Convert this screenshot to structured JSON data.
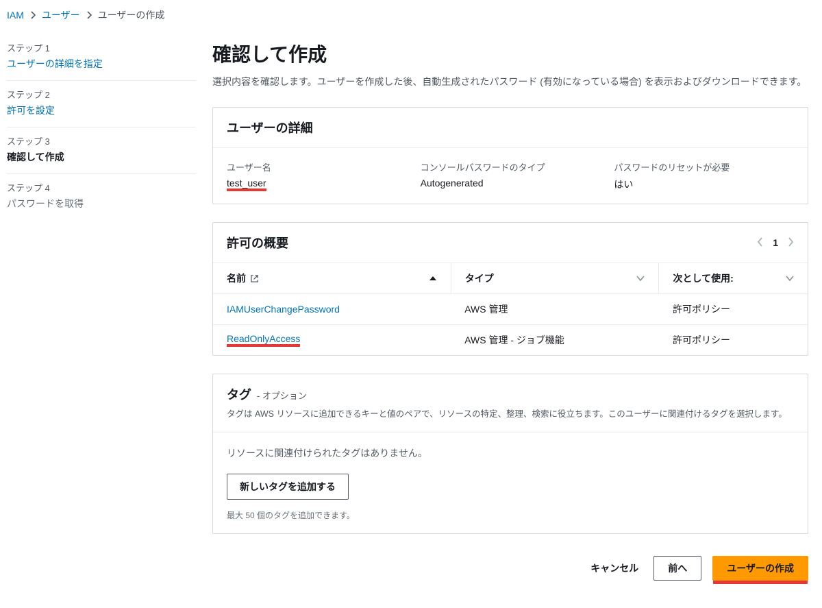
{
  "breadcrumb": {
    "items": [
      "IAM",
      "ユーザー",
      "ユーザーの作成"
    ]
  },
  "sidebar": {
    "steps": [
      {
        "num": "ステップ 1",
        "title": "ユーザーの詳細を指定",
        "state": "link"
      },
      {
        "num": "ステップ 2",
        "title": "許可を設定",
        "state": "link"
      },
      {
        "num": "ステップ 3",
        "title": "確認して作成",
        "state": "current"
      },
      {
        "num": "ステップ 4",
        "title": "パスワードを取得",
        "state": "disabled"
      }
    ]
  },
  "page": {
    "title": "確認して作成",
    "desc": "選択内容を確認します。ユーザーを作成した後、自動生成されたパスワード (有効になっている場合) を表示およびダウンロードできます。"
  },
  "user_details": {
    "panel_title": "ユーザーの詳細",
    "username_label": "ユーザー名",
    "username_value": "test_user",
    "pwtype_label": "コンソールパスワードのタイプ",
    "pwtype_value": "Autogenerated",
    "reset_label": "パスワードのリセットが必要",
    "reset_value": "はい"
  },
  "permissions": {
    "panel_title": "許可の概要",
    "page_number": "1",
    "columns": {
      "name": "名前",
      "type": "タイプ",
      "used_as": "次として使用:"
    },
    "rows": [
      {
        "name": "IAMUserChangePassword",
        "type": "AWS 管理",
        "used_as": "許可ポリシー",
        "highlight": false
      },
      {
        "name": "ReadOnlyAccess",
        "type": "AWS 管理 - ジョブ機能",
        "used_as": "許可ポリシー",
        "highlight": true
      }
    ]
  },
  "tags": {
    "title": "タグ",
    "subtitle": "- オプション",
    "desc": "タグは AWS リソースに追加できるキーと値のペアで、リソースの特定、整理、検索に役立ちます。このユーザーに関連付けるタグを選択します。",
    "empty": "リソースに関連付けられたタグはありません。",
    "add_button": "新しいタグを追加する",
    "hint": "最大 50 個のタグを追加できます。"
  },
  "footer": {
    "cancel": "キャンセル",
    "back": "前へ",
    "create": "ユーザーの作成"
  }
}
